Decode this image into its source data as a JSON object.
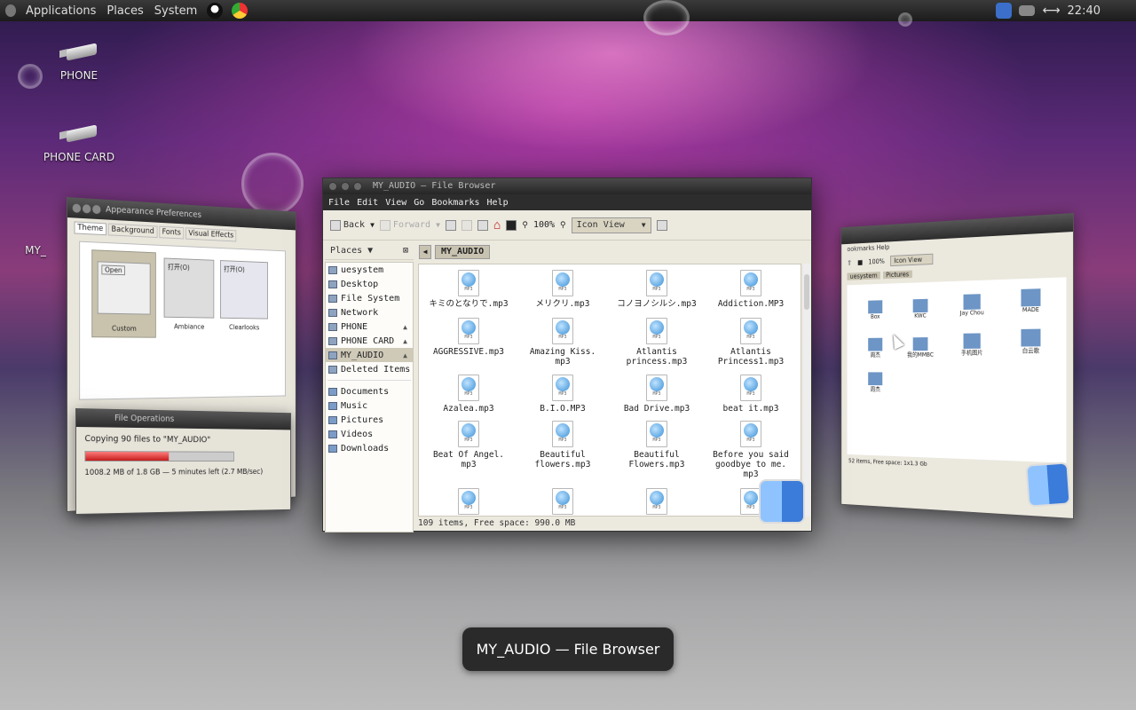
{
  "topbar": {
    "menus": [
      "Applications",
      "Places",
      "System"
    ],
    "clock": "22:40"
  },
  "desktop": {
    "icons": [
      {
        "label": "PHONE"
      },
      {
        "label": "PHONE CARD"
      },
      {
        "label": "MY_"
      }
    ]
  },
  "appearance_window": {
    "title": "Appearance Preferences",
    "tabs": [
      "Theme",
      "Background",
      "Fonts",
      "Visual Effects"
    ],
    "themes": [
      "Custom",
      "Ambiance",
      "Clearlooks"
    ],
    "sample_button": "Open",
    "sample_button2": "打开(O)"
  },
  "file_ops_window": {
    "title": "File Operations",
    "copy_text": "Copying 90 files to \"MY_AUDIO\"",
    "progress_text": "1008.2 MB of 1.8 GB — 5 minutes left (2.7 MB/sec)",
    "progress_fraction": 0.55
  },
  "right_window": {
    "menu_fragment": "ookmarks Help",
    "zoom": "100%",
    "view": "Icon View",
    "crumbs": [
      "uesystem",
      "Pictures"
    ],
    "folders": [
      "Box",
      "KWC",
      "Jay Chou",
      "MADE",
      "周杰",
      "我的MMBC",
      "手机图片",
      "白云歌",
      "周杰"
    ],
    "status": "52 items, Free space: 1x1.3 Gb"
  },
  "main_window": {
    "title": "MY_AUDIO — File Browser",
    "menu": [
      "File",
      "Edit",
      "View",
      "Go",
      "Bookmarks",
      "Help"
    ],
    "toolbar": {
      "back": "Back",
      "forward": "Forward",
      "zoom": "100%",
      "view": "Icon View"
    },
    "places_label": "Places",
    "places": [
      {
        "label": "uesystem",
        "eject": false
      },
      {
        "label": "Desktop",
        "eject": false
      },
      {
        "label": "File System",
        "eject": false
      },
      {
        "label": "Network",
        "eject": false
      },
      {
        "label": "PHONE",
        "eject": true
      },
      {
        "label": "PHONE CARD",
        "eject": true
      },
      {
        "label": "MY_AUDIO",
        "eject": true,
        "selected": true
      },
      {
        "label": "Deleted Items",
        "eject": false
      }
    ],
    "bookmarks": [
      "Documents",
      "Music",
      "Pictures",
      "Videos",
      "Downloads"
    ],
    "path": "MY_AUDIO",
    "files": [
      "キミのとなりで.mp3",
      "メリクリ.mp3",
      "コノヨノシルシ.mp3",
      "Addiction.MP3",
      "AGGRESSIVE.mp3",
      "Amazing Kiss.\nmp3",
      "Atlantis\nprincess.mp3",
      "Atlantis\nPrincess1.mp3",
      "Azalea.mp3",
      "B.I.O.MP3",
      "Bad Drive.mp3",
      "beat it.mp3",
      "Beat Of Angel.\nmp3",
      "Beautiful\nflowers.mp3",
      "Beautiful\nFlowers.mp3",
      "Before you said\ngoodbye to me.\nmp3",
      "",
      "",
      "",
      ""
    ],
    "file_badge": "MP3",
    "status": "109 items, Free space: 990.0 MB"
  },
  "tooltip": "MY_AUDIO — File Browser",
  "colors": {
    "accent_red": "#c41c1c",
    "panel_dark": "#1b1b1b",
    "window_bg": "#ece9df"
  }
}
